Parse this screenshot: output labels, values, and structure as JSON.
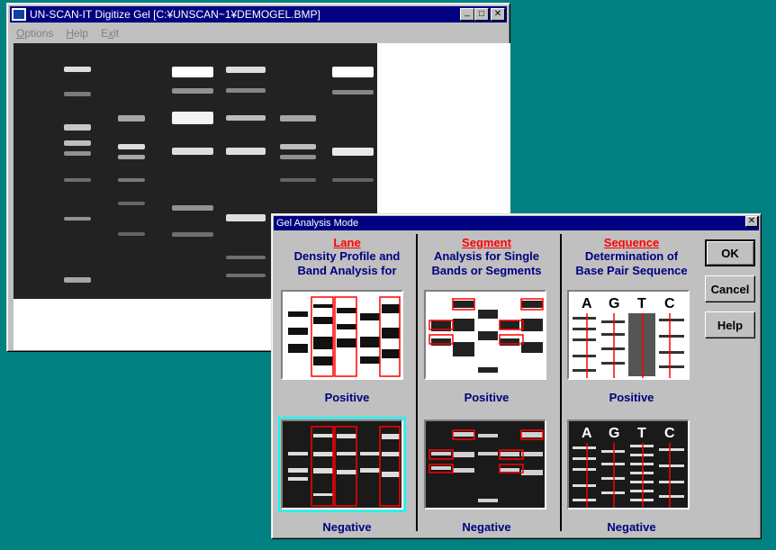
{
  "main_window": {
    "title": "UN-SCAN-IT Digitize Gel  [C:¥UNSCAN~1¥DEMOGEL.BMP]",
    "app_icon": "unscanit-app-icon",
    "controls": {
      "minimize": "_",
      "maximize": "□",
      "close": "✕"
    },
    "menu": [
      {
        "label": "Options",
        "hotkey": "O",
        "rest": "ptions"
      },
      {
        "label": "Help",
        "hotkey": "H",
        "rest": "elp"
      },
      {
        "label": "Exit",
        "hotkey": "x",
        "rest": "it",
        "pre": "E"
      }
    ]
  },
  "dialog": {
    "title": "Gel Analysis Mode",
    "close": "✕",
    "columns": [
      {
        "mode": "Lane",
        "desc1": "Density Profile and",
        "desc2": "Band Analysis for",
        "positive": "Positive",
        "negative": "Negative"
      },
      {
        "mode": "Segment",
        "desc1": "Analysis for Single",
        "desc2": "Bands or Segments",
        "positive": "Positive",
        "negative": "Negative"
      },
      {
        "mode": "Sequence",
        "desc1": "Determination of",
        "desc2": "Base Pair Sequence",
        "positive": "Positive",
        "negative": "Negative",
        "bases": [
          "A",
          "G",
          "T",
          "C"
        ]
      }
    ],
    "buttons": {
      "ok": "OK",
      "cancel": "Cancel",
      "help": "Help"
    },
    "selected_thumbnail": "lane-negative",
    "colors": {
      "title_bar": "#000080",
      "mode_label": "#ff0000",
      "desc_text": "#000080",
      "selection": "#00ffff"
    }
  }
}
